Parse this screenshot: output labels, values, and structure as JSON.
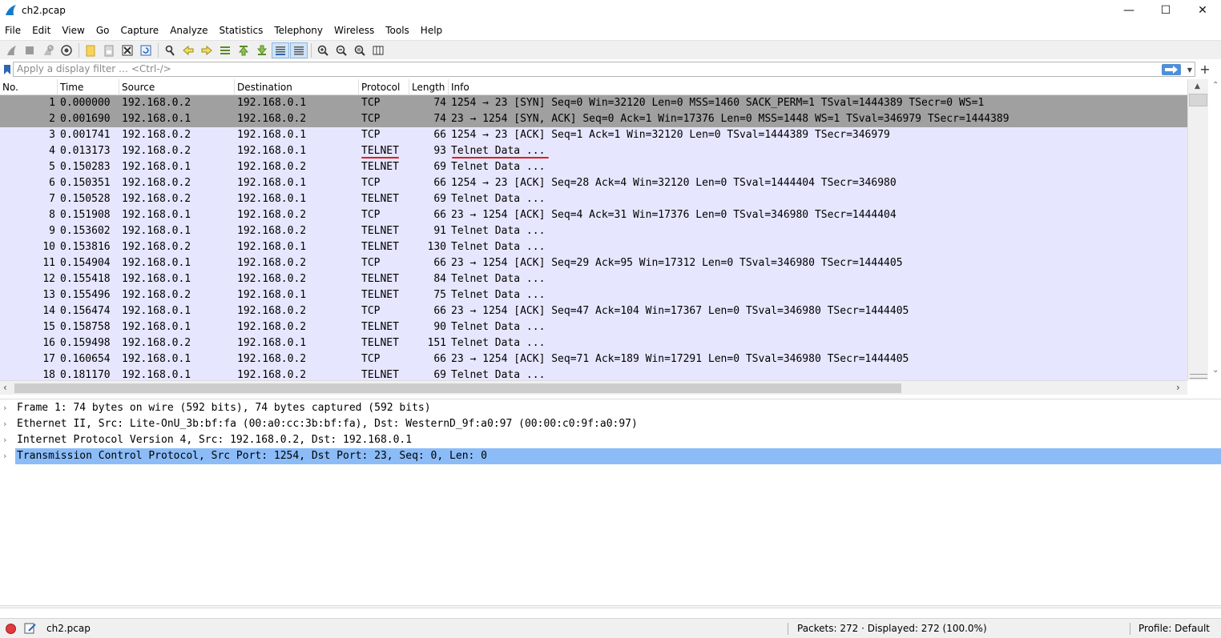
{
  "window": {
    "title": "ch2.pcap",
    "minimize": "—",
    "maximize": "☐",
    "close": "✕"
  },
  "menu": [
    "File",
    "Edit",
    "View",
    "Go",
    "Capture",
    "Analyze",
    "Statistics",
    "Telephony",
    "Wireless",
    "Tools",
    "Help"
  ],
  "filter": {
    "placeholder": "Apply a display filter … <Ctrl-/>"
  },
  "columns": {
    "no": "No.",
    "time": "Time",
    "source": "Source",
    "destination": "Destination",
    "protocol": "Protocol",
    "length": "Length",
    "info": "Info"
  },
  "packets": [
    {
      "no": "1",
      "time": "0.000000",
      "src": "192.168.0.2",
      "dst": "192.168.0.1",
      "proto": "TCP",
      "len": "74",
      "info": "1254 → 23 [SYN] Seq=0 Win=32120 Len=0 MSS=1460 SACK_PERM=1 TSval=1444389 TSecr=0 WS=1"
    },
    {
      "no": "2",
      "time": "0.001690",
      "src": "192.168.0.1",
      "dst": "192.168.0.2",
      "proto": "TCP",
      "len": "74",
      "info": "23 → 1254 [SYN, ACK] Seq=0 Ack=1 Win=17376 Len=0 MSS=1448 WS=1 TSval=346979 TSecr=1444389"
    },
    {
      "no": "3",
      "time": "0.001741",
      "src": "192.168.0.2",
      "dst": "192.168.0.1",
      "proto": "TCP",
      "len": "66",
      "info": "1254 → 23 [ACK] Seq=1 Ack=1 Win=32120 Len=0 TSval=1444389 TSecr=346979"
    },
    {
      "no": "4",
      "time": "0.013173",
      "src": "192.168.0.2",
      "dst": "192.168.0.1",
      "proto": "TELNET",
      "len": "93",
      "info": "Telnet Data ..."
    },
    {
      "no": "5",
      "time": "0.150283",
      "src": "192.168.0.1",
      "dst": "192.168.0.2",
      "proto": "TELNET",
      "len": "69",
      "info": "Telnet Data ..."
    },
    {
      "no": "6",
      "time": "0.150351",
      "src": "192.168.0.2",
      "dst": "192.168.0.1",
      "proto": "TCP",
      "len": "66",
      "info": "1254 → 23 [ACK] Seq=28 Ack=4 Win=32120 Len=0 TSval=1444404 TSecr=346980"
    },
    {
      "no": "7",
      "time": "0.150528",
      "src": "192.168.0.2",
      "dst": "192.168.0.1",
      "proto": "TELNET",
      "len": "69",
      "info": "Telnet Data ..."
    },
    {
      "no": "8",
      "time": "0.151908",
      "src": "192.168.0.1",
      "dst": "192.168.0.2",
      "proto": "TCP",
      "len": "66",
      "info": "23 → 1254 [ACK] Seq=4 Ack=31 Win=17376 Len=0 TSval=346980 TSecr=1444404"
    },
    {
      "no": "9",
      "time": "0.153602",
      "src": "192.168.0.1",
      "dst": "192.168.0.2",
      "proto": "TELNET",
      "len": "91",
      "info": "Telnet Data ..."
    },
    {
      "no": "10",
      "time": "0.153816",
      "src": "192.168.0.2",
      "dst": "192.168.0.1",
      "proto": "TELNET",
      "len": "130",
      "info": "Telnet Data ..."
    },
    {
      "no": "11",
      "time": "0.154904",
      "src": "192.168.0.1",
      "dst": "192.168.0.2",
      "proto": "TCP",
      "len": "66",
      "info": "23 → 1254 [ACK] Seq=29 Ack=95 Win=17312 Len=0 TSval=346980 TSecr=1444405"
    },
    {
      "no": "12",
      "time": "0.155418",
      "src": "192.168.0.1",
      "dst": "192.168.0.2",
      "proto": "TELNET",
      "len": "84",
      "info": "Telnet Data ..."
    },
    {
      "no": "13",
      "time": "0.155496",
      "src": "192.168.0.2",
      "dst": "192.168.0.1",
      "proto": "TELNET",
      "len": "75",
      "info": "Telnet Data ..."
    },
    {
      "no": "14",
      "time": "0.156474",
      "src": "192.168.0.1",
      "dst": "192.168.0.2",
      "proto": "TCP",
      "len": "66",
      "info": "23 → 1254 [ACK] Seq=47 Ack=104 Win=17367 Len=0 TSval=346980 TSecr=1444405"
    },
    {
      "no": "15",
      "time": "0.158758",
      "src": "192.168.0.1",
      "dst": "192.168.0.2",
      "proto": "TELNET",
      "len": "90",
      "info": "Telnet Data ..."
    },
    {
      "no": "16",
      "time": "0.159498",
      "src": "192.168.0.2",
      "dst": "192.168.0.1",
      "proto": "TELNET",
      "len": "151",
      "info": "Telnet Data ..."
    },
    {
      "no": "17",
      "time": "0.160654",
      "src": "192.168.0.1",
      "dst": "192.168.0.2",
      "proto": "TCP",
      "len": "66",
      "info": "23 → 1254 [ACK] Seq=71 Ack=189 Win=17291 Len=0 TSval=346980 TSecr=1444405"
    },
    {
      "no": "18",
      "time": "0.181170",
      "src": "192.168.0.1",
      "dst": "192.168.0.2",
      "proto": "TELNET",
      "len": "69",
      "info": "Telnet Data ..."
    }
  ],
  "details": [
    {
      "text": "Frame 1: 74 bytes on wire (592 bits), 74 bytes captured (592 bits)"
    },
    {
      "text": "Ethernet II, Src: Lite-OnU_3b:bf:fa (00:a0:cc:3b:bf:fa), Dst: WesternD_9f:a0:97 (00:00:c0:9f:a0:97)"
    },
    {
      "text": "Internet Protocol Version 4, Src: 192.168.0.2, Dst: 192.168.0.1"
    },
    {
      "text": "Transmission Control Protocol, Src Port: 1254, Dst Port: 23, Seq: 0, Len: 0"
    }
  ],
  "status": {
    "file": "ch2.pcap",
    "packets": "Packets: 272 · Displayed: 272 (100.0%)",
    "profile": "Profile: Default"
  },
  "colors": {
    "row_bg": "#e7e6ff",
    "row_selected": "#a0a0a0",
    "detail_selected": "#8bbcf8",
    "annotation_red": "#e0201a"
  }
}
